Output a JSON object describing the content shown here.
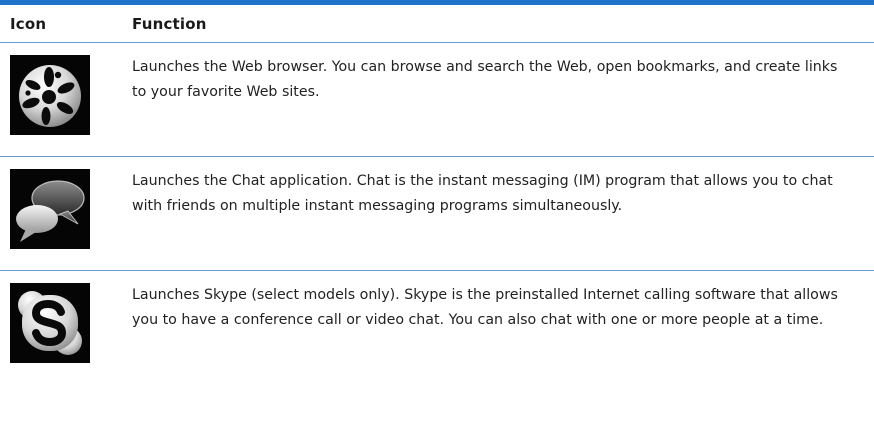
{
  "header": {
    "icon_col": "Icon",
    "function_col": "Function"
  },
  "rows": [
    {
      "icon": "web-browser-icon",
      "text": "Launches the Web browser. You can browse and search the Web, open bookmarks, and create links to your favorite Web sites."
    },
    {
      "icon": "chat-bubbles-icon",
      "text": "Launches the Chat application. Chat is the instant messaging (IM) program that allows you to chat with friends on multiple instant messaging programs simultaneously."
    },
    {
      "icon": "skype-icon",
      "text": "Launches Skype (select models only). Skype is the preinstalled Internet calling software that allows you to have a conference call or video chat. You can also chat with one or more people at a time."
    }
  ],
  "colors": {
    "rule": "#1f73c9",
    "divider": "#6a9ad8",
    "icon_bg": "#050505"
  }
}
